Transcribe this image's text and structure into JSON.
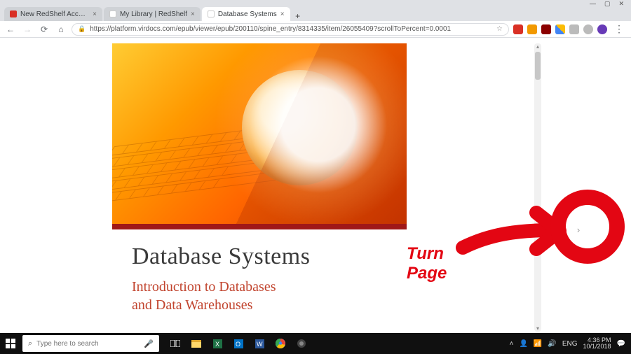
{
  "window_controls": {
    "minimize": "—",
    "maximize": "▢",
    "close": "✕"
  },
  "tabs": [
    {
      "title": "New RedShelf Account Setup - a",
      "active": false,
      "favicon": "#d93025"
    },
    {
      "title": "My Library | RedShelf",
      "active": false,
      "favicon": "#ffffff"
    },
    {
      "title": "Database Systems",
      "active": true,
      "favicon": "#ffffff"
    }
  ],
  "new_tab": "+",
  "nav": {
    "back": "←",
    "forward": "→",
    "reload": "⟳",
    "home": "⌂"
  },
  "omnibox": {
    "lock": "🔒",
    "url": "https://platform.virdocs.com/epub/viewer/epub/200110/spine_entry/8314335/item/26055409?scrollToPercent=0.0001",
    "bookmark_icon": "☆"
  },
  "book": {
    "title": "Database Systems",
    "subtitle_line1": "Introduction to Databases",
    "subtitle_line2": "and Data Warehouses"
  },
  "next_page_glyph": "›",
  "annotation": {
    "line1": "Turn",
    "line2": "Page"
  },
  "taskbar": {
    "search_placeholder": "Type here to search",
    "tray": {
      "lang": "ENG",
      "time": "4:36 PM",
      "date": "10/1/2018",
      "up_arrow": "˄",
      "people": "👤",
      "wifi": "📶",
      "volume": "🔊",
      "notif": "💬"
    }
  }
}
